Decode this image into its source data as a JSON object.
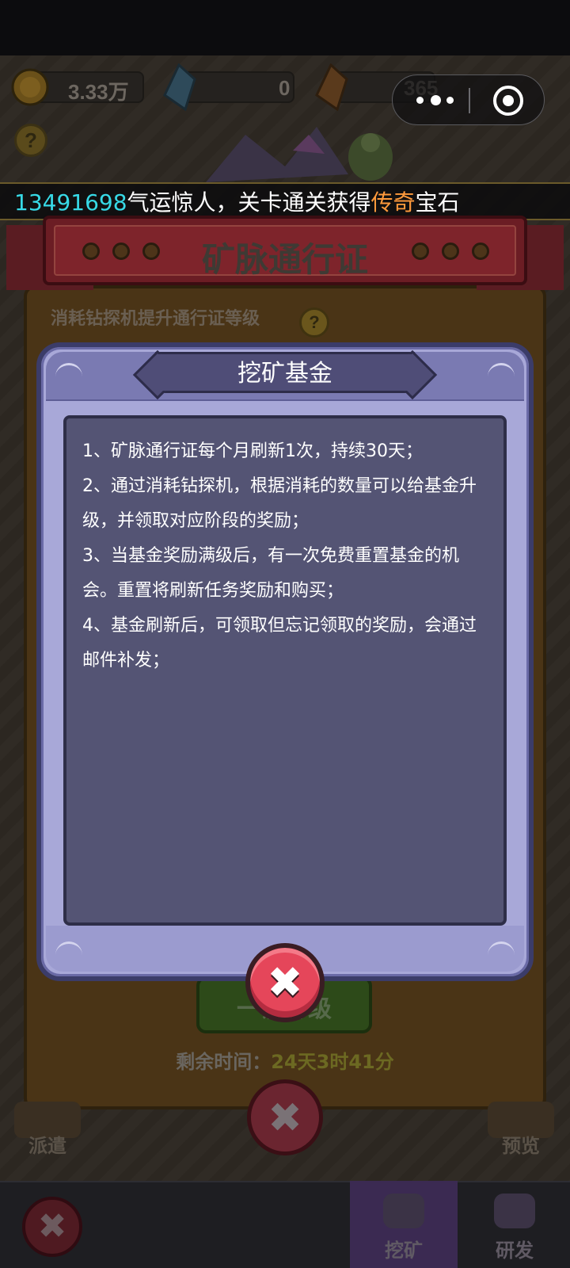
{
  "hud": {
    "gold_value": "3.33万",
    "blue_gem_value": "0",
    "orange_gem_value": "365"
  },
  "marquee": {
    "player_id": "13491698",
    "text_before": "气运惊人，关卡通关获得",
    "highlight": "传奇",
    "text_after": "宝石"
  },
  "background_panel": {
    "title": "矿脉通行证",
    "subtitle": "消耗钻探机提升通行证等级",
    "green_button_label": "一键升级",
    "remaining_label": "剩余时间：",
    "remaining_value": "24天3时41分",
    "left_side_label": "派遣",
    "right_side_label": "预览"
  },
  "bottom_tabs": [
    {
      "label": "挖矿",
      "active": true
    },
    {
      "label": "研发",
      "active": false
    }
  ],
  "dialog": {
    "title": "挖矿基金",
    "rules": [
      "1、矿脉通行证每个月刷新1次，持续30天；",
      "2、通过消耗钻探机，根据消耗的数量可以给基金升级，并领取对应阶段的奖励；",
      "3、当基金奖励满级后，有一次免费重置基金的机会。重置将刷新任务奖励和购买；",
      "4、基金刷新后，可领取但忘记领取的奖励，会通过邮件补发；"
    ]
  },
  "colors": {
    "dialog_frame": "#a8a8d8",
    "content_bg": "#545474",
    "close_red": "#e5465a",
    "marquee_id": "#37d9e6",
    "marquee_highlight": "#ff9a3c"
  },
  "icons": {
    "capsule_menu": "more-dots-icon",
    "capsule_close": "target-circle-icon",
    "close": "close-x-icon",
    "help": "question-icon"
  }
}
